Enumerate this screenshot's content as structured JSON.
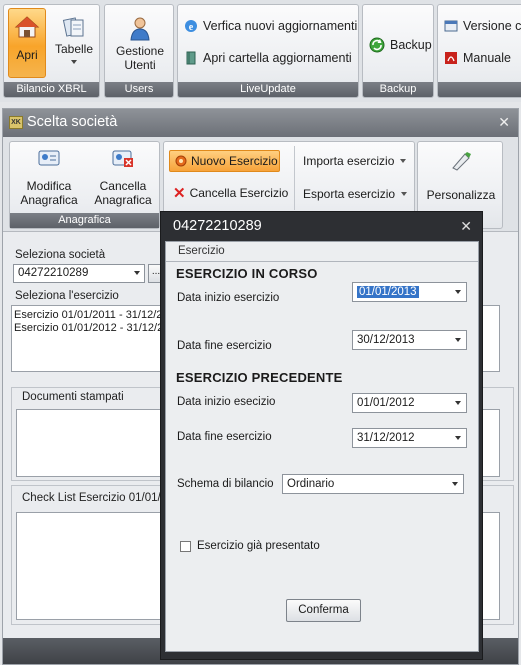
{
  "ribbon": {
    "groups": [
      {
        "label": "Bilancio XBRL"
      },
      {
        "label": "Users"
      },
      {
        "label": "LiveUpdate"
      },
      {
        "label": "Backup"
      }
    ],
    "apri": "Apri",
    "tabelle": "Tabelle",
    "gestione_utenti": "Gestione Utenti",
    "verifica": "Verfica nuovi aggiornamenti",
    "apri_cartella": "Apri cartella aggiornamenti",
    "backup": "Backup",
    "versione": "Versione co",
    "manuale": "Manuale"
  },
  "window": {
    "title": "Scelta società",
    "ribbon": {
      "modifica": "Modifica Anagrafica",
      "cancella": "Cancella Anagrafica",
      "group_anagrafica": "Anagrafica",
      "nuovo_esercizio": "Nuovo Esercizio",
      "cancella_esercizio": "Cancella Esercizio",
      "importa": "Importa esercizio",
      "esporta": "Esporta esercizio",
      "personalizza": "Personalizza"
    },
    "seleziona_societa_label": "Seleziona società",
    "societa_value": "04272210289",
    "seleziona_esercizio_label": "Seleziona l'esercizio",
    "esercizi": [
      "Esercizio 01/01/2011 - 31/12/2",
      "Esercizio 01/01/2012 - 31/12/2"
    ],
    "documenti_label": "Documenti stampati",
    "checklist_label": "Check List Esercizio 01/01/2"
  },
  "dialog": {
    "title": "04272210289",
    "tab": "Esercizio",
    "section_current": "ESERCIZIO IN CORSO",
    "start_label": "Data inizio esercizio",
    "end_label": "Data fine esercizio",
    "current_start": "01/01/2013",
    "current_end": "30/12/2013",
    "section_previous": "ESERCIZIO PRECEDENTE",
    "prev_start_label": "Data inizio esecizio",
    "prev_end_label": "Data fine esercizio",
    "prev_start": "01/01/2012",
    "prev_end": "31/12/2012",
    "schema_label": "Schema di bilancio",
    "schema_value": "Ordinario",
    "checkbox_label": "Esercizio già presentato",
    "confirm": "Conferma"
  }
}
